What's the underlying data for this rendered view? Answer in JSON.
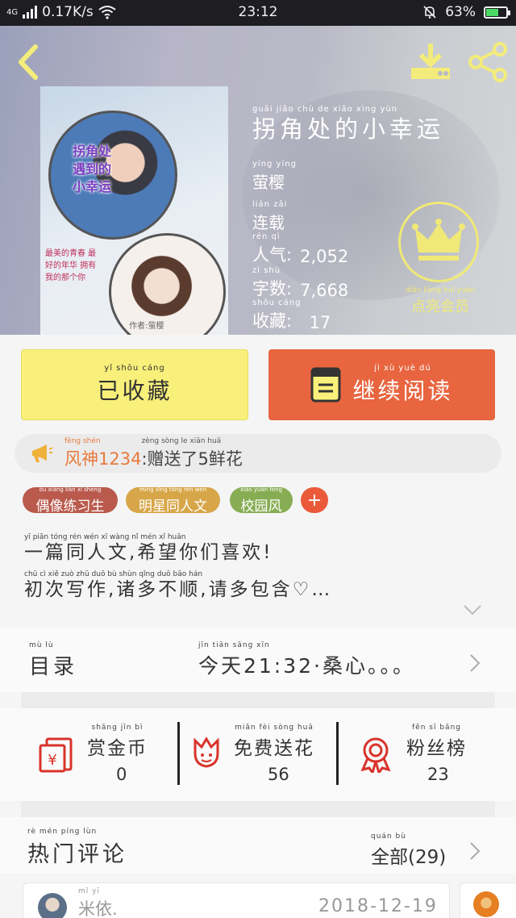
{
  "status_bar": {
    "network": "4G",
    "speed": "0.17K/s",
    "time": "23:12",
    "battery": "63%",
    "battery_level": 0.63
  },
  "book": {
    "title_pinyin": "guāi  jiǎo  chù   de   xiǎo  xìng  yùn",
    "title": "拐角处的小幸运",
    "author_pinyin": "yíng yíng",
    "author": "萤樱",
    "status_pinyin": "lián  zǎi",
    "status": "连载",
    "popularity_pinyin": "rén   qì",
    "popularity_label": "人气:",
    "popularity": "2,052",
    "words_pinyin": "zì    shù",
    "words_label": "字数:",
    "words": "7,668",
    "favorites_pinyin": "shōu cáng",
    "favorites_label": "收藏:",
    "favorites": "17",
    "cover_title": "拐角处遇到的小幸运",
    "cover_subtitle": "最美的青春 最好的年华 拥有我的那个你",
    "cover_author": "作者:萤樱"
  },
  "vip": {
    "pinyin": "diǎn liàng huì yuán",
    "label": "点亮会员"
  },
  "actions": {
    "collected_pinyin": "yǐ  shōu cáng",
    "collected_label": "已收藏",
    "read_pinyin": "jì   xù   yuè  dú",
    "read_label": "继续阅读"
  },
  "flower_banner": {
    "name_pinyin": "fēng shén",
    "name": "风神1234",
    "msg_pinyin": "zèng sòng  le       xiān huā",
    "msg": ":赠送了5鲜花"
  },
  "tags": [
    {
      "pinyin": "ǒu xiàng liàn xí shēng",
      "label": "偶像练习生"
    },
    {
      "pinyin": "míng xīng tóng rén wén",
      "label": "明星同人文"
    },
    {
      "pinyin": "xiào yuán fēng",
      "label": "校园风"
    }
  ],
  "tag_add_label": "+",
  "description": {
    "line1_pinyin": "yī  piān tóng rén  wén          xī  wàng  nǐ  mén  xǐ  huān",
    "line1": "一篇同人文,希望你们喜欢!",
    "line2_pinyin": "chū  cì  xiě  zuò       zhū  duō  bù  shùn       qǐng duō  bāo  hán",
    "line2": "初次写作,诸多不顺,请多包含♡…"
  },
  "toc": {
    "pinyin": "mù  lù",
    "label": "目录",
    "latest_pinyin": "jīn  tiān                       sāng  xīn",
    "latest": "今天21:32·桑心。。。"
  },
  "stats": [
    {
      "pinyin": "shǎng jīn  bì",
      "label": "赏金币",
      "value": "0"
    },
    {
      "pinyin": "miǎn fèi sòng huā",
      "label": "免费送花",
      "value": "56"
    },
    {
      "pinyin": "fěn  sī  bǎng",
      "label": "粉丝榜",
      "value": "23"
    }
  ],
  "hot_comments": {
    "pinyin": "rè  mén píng lùn",
    "label": "热门评论",
    "all_pinyin": "quán  bù",
    "all_label": "全部(29)"
  },
  "comments": [
    {
      "user_pinyin": "mǐ  yī",
      "user": "米依.",
      "date": "2018-12-19"
    }
  ],
  "colors": {
    "collected_btn": "#f8f07a",
    "read_btn": "#e8653f",
    "vip": "#f0e977",
    "tag_1": "#b95a4d",
    "tag_2": "#d7a648",
    "tag_3": "#87ad54",
    "tag_add": "#ea5a3a"
  }
}
